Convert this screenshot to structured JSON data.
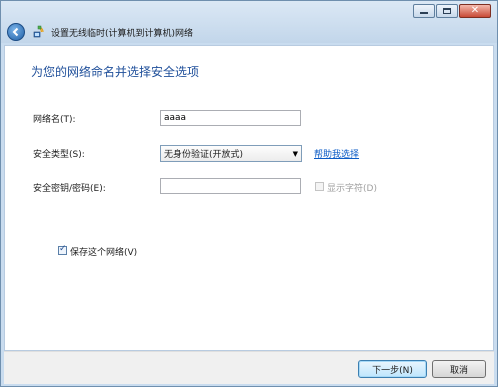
{
  "window": {
    "title": "设置无线临时(计算机到计算机)网络",
    "controls": {
      "minimize": "minimize-icon",
      "maximize": "maximize-icon",
      "close": "close-icon"
    }
  },
  "heading": "为您的网络命名并选择安全选项",
  "form": {
    "network_name_label": "网络名(T):",
    "network_name_value": "aaaa",
    "security_type_label": "安全类型(S):",
    "security_type_value": "无身份验证(开放式)",
    "help_link": "帮助我选择",
    "security_key_label": "安全密钥/密码(E):",
    "security_key_value": "",
    "show_chars_label": "显示字符(D)",
    "show_chars_checked": false,
    "save_network_label": "保存这个网络(V)",
    "save_network_checked": true
  },
  "buttons": {
    "next": "下一步(N)",
    "cancel": "取消"
  },
  "colors": {
    "heading": "#1f4f9a",
    "link": "#0b5bc6",
    "frame": "#c9dcef"
  }
}
